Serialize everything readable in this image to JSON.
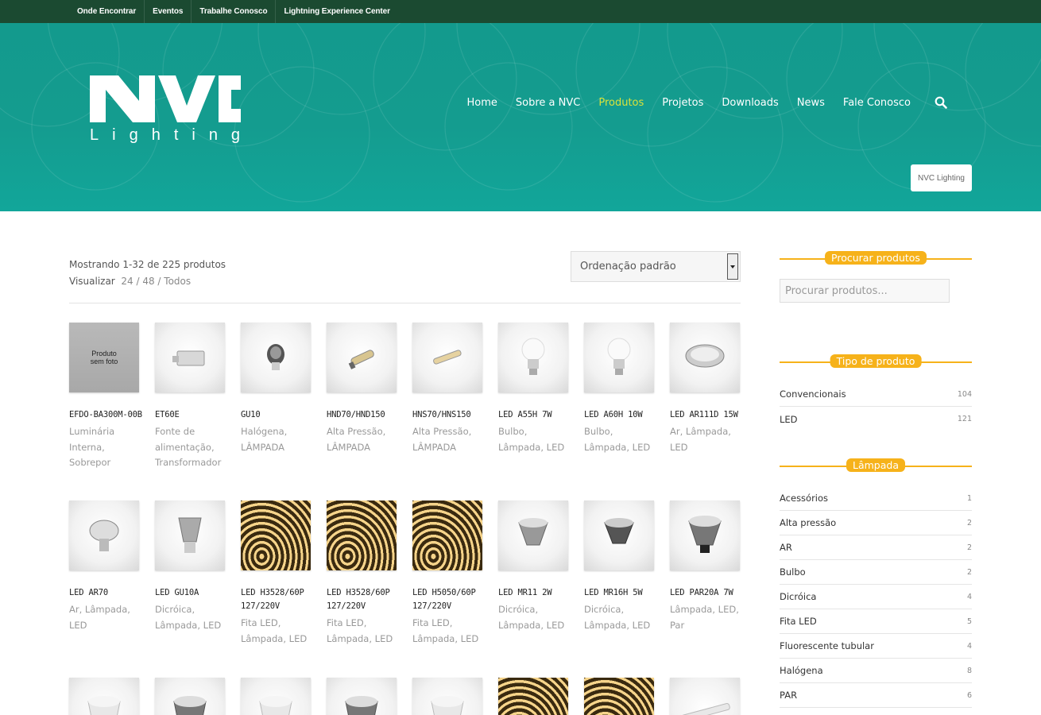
{
  "topbar": {
    "links": [
      "Onde Encontrar",
      "Eventos",
      "Trabalhe Conosco",
      "Lightning Experience Center"
    ]
  },
  "header": {
    "logo_text": "NVC",
    "logo_subtext": "Lighting",
    "nav": [
      "Home",
      "Sobre a NVC",
      "Produtos",
      "Projetos",
      "Downloads",
      "News",
      "Fale Conosco"
    ],
    "active_nav": "Produtos",
    "brand_button": "NVC Lighting"
  },
  "colors": {
    "topbar": "#1b4a31",
    "header": "#139a8d",
    "accent_nav": "#d9e23a",
    "widget_accent": "#f6b21a"
  },
  "results": {
    "count_text": "Mostrando 1-32 de 225 produtos",
    "view_label": "Visualizar",
    "view_options": "24 / 48 / Todos"
  },
  "sort": {
    "selected": "Ordenação padrão"
  },
  "products": [
    {
      "name": "EFDO-BA300M-00B",
      "cats": "Luminária Interna, Sobrepor",
      "icon": "no-photo",
      "placeholder": "Produto sem foto"
    },
    {
      "name": "ET60E",
      "cats": "Fonte de alimentação, Transformador",
      "icon": "transformer"
    },
    {
      "name": "GU10",
      "cats": "Halógena, LÂMPADA",
      "icon": "halogen"
    },
    {
      "name": "HND70/HND150",
      "cats": "Alta Pressão, LÂMPADA",
      "icon": "hid-lamp"
    },
    {
      "name": "HNS70/HNS150",
      "cats": "Alta Pressão, LÂMPADA",
      "icon": "tube-lamp"
    },
    {
      "name": "LED A55H 7W",
      "cats": "Bulbo, Lâmpada, LED",
      "icon": "bulb"
    },
    {
      "name": "LED A60H 10W",
      "cats": "Bulbo, Lâmpada, LED",
      "icon": "bulb"
    },
    {
      "name": "LED AR111D 15W",
      "cats": "Ar, Lâmpada, LED",
      "icon": "ar111"
    },
    {
      "name": "LED AR70",
      "cats": "Ar, Lâmpada, LED",
      "icon": "ar70"
    },
    {
      "name": "LED GU10A",
      "cats": "Dicróica, Lâmpada, LED",
      "icon": "gu10"
    },
    {
      "name": "LED H3528/60P 127/220V",
      "cats": "Fita LED, Lâmpada, LED",
      "icon": "strip"
    },
    {
      "name": "LED H3528/60P 127/220V",
      "cats": "Fita LED, Lâmpada, LED",
      "icon": "strip"
    },
    {
      "name": "LED H5050/60P 127/220V",
      "cats": "Fita LED, Lâmpada, LED",
      "icon": "strip"
    },
    {
      "name": "LED MR11 2W",
      "cats": "Dicróica, Lâmpada, LED",
      "icon": "mr"
    },
    {
      "name": "LED MR16H 5W",
      "cats": "Dicróica, Lâmpada, LED",
      "icon": "mr-dark"
    },
    {
      "name": "LED PAR20A 7W",
      "cats": "Lâmpada, LED, Par",
      "icon": "par"
    },
    {
      "name": "",
      "cats": "",
      "icon": "par-white"
    },
    {
      "name": "",
      "cats": "",
      "icon": "par-dark"
    },
    {
      "name": "",
      "cats": "",
      "icon": "par-white"
    },
    {
      "name": "",
      "cats": "",
      "icon": "par-dark"
    },
    {
      "name": "",
      "cats": "",
      "icon": "par-white"
    },
    {
      "name": "",
      "cats": "",
      "icon": "strip"
    },
    {
      "name": "",
      "cats": "",
      "icon": "strip"
    },
    {
      "name": "",
      "cats": "",
      "icon": "tube"
    }
  ],
  "sidebar": {
    "search_title": "Procurar produtos",
    "search_placeholder": "Procurar produtos...",
    "type_title": "Tipo de produto",
    "types": [
      {
        "label": "Convencionais",
        "count": "104"
      },
      {
        "label": "LED",
        "count": "121"
      }
    ],
    "lamp_title": "Lâmpada",
    "lamps": [
      {
        "label": "Acessórios",
        "count": "1"
      },
      {
        "label": "Alta pressão",
        "count": "2"
      },
      {
        "label": "AR",
        "count": "2"
      },
      {
        "label": "Bulbo",
        "count": "2"
      },
      {
        "label": "Dicróica",
        "count": "4"
      },
      {
        "label": "Fita LED",
        "count": "5"
      },
      {
        "label": "Fluorescente tubular",
        "count": "4"
      },
      {
        "label": "Halógena",
        "count": "8"
      },
      {
        "label": "PAR",
        "count": "6"
      }
    ]
  }
}
